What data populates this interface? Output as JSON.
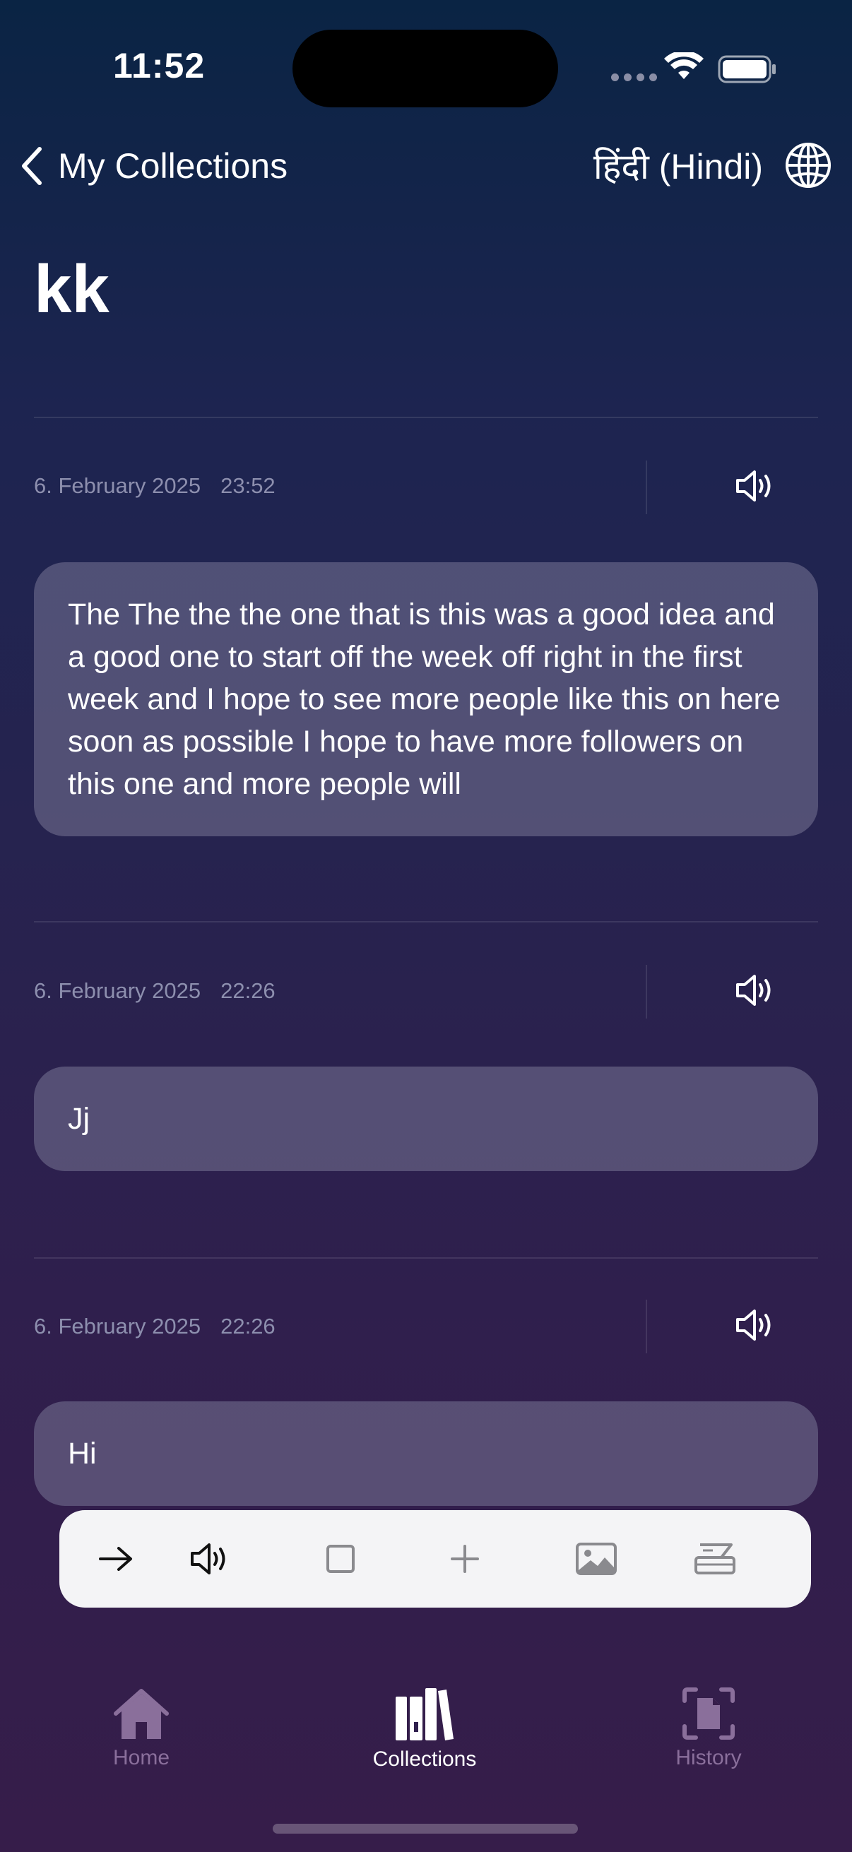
{
  "status_bar": {
    "time": "11:52"
  },
  "nav": {
    "back_label": "My Collections",
    "language_label": "हिंदी (Hindi)"
  },
  "page_title": "kk",
  "entries": [
    {
      "date": "6. February 2025",
      "time": "23:52",
      "text": "The The the the one that is this was a good idea and a good one to start off the week off right in the first week and I hope to see more people like this on here soon as possible I hope to have more followers on this one and more people will"
    },
    {
      "date": "6. February 2025",
      "time": "22:26",
      "text": "Jj"
    },
    {
      "date": "6. February 2025",
      "time": "22:26",
      "text": "Hi"
    }
  ],
  "toolbar": {
    "icons": [
      "arrow-right-icon",
      "speaker-icon",
      "square-icon",
      "plus-icon",
      "image-icon",
      "scanner-icon"
    ]
  },
  "tab_bar": {
    "items": [
      {
        "label": "Home",
        "icon": "house-icon",
        "active": false
      },
      {
        "label": "Collections",
        "icon": "books-icon",
        "active": true
      },
      {
        "label": "History",
        "icon": "doc-scan-icon",
        "active": false
      }
    ]
  },
  "colors": {
    "background_top": "#0a2444",
    "background_bottom": "#361d4a",
    "meta_text": "#8d8fae",
    "tab_inactive": "#8a6f9b",
    "toolbar_bg": "#f4f4f6"
  }
}
